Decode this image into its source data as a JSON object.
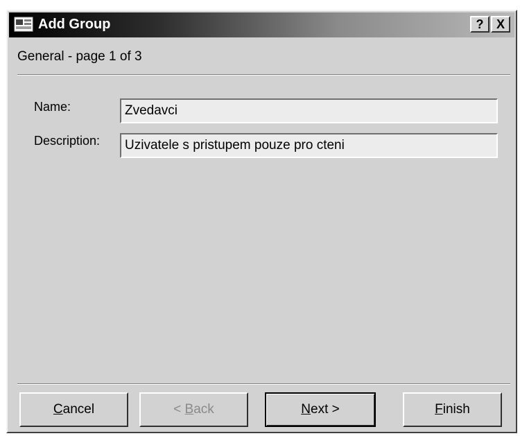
{
  "window": {
    "title": "Add Group",
    "icon": "window-app-icon",
    "help_label": "?",
    "close_label": "X"
  },
  "page": {
    "heading": "General - page 1 of 3"
  },
  "form": {
    "name_label": "Name:",
    "name_value": "Zvedavci",
    "description_label": "Description:",
    "description_value": "Uzivatele s pristupem pouze pro cteni"
  },
  "buttons": {
    "cancel": {
      "mnemonic": "C",
      "rest": "ancel"
    },
    "back": {
      "prefix": "< ",
      "mnemonic": "B",
      "rest": "ack",
      "enabled": false
    },
    "next": {
      "mnemonic": "N",
      "rest": "ext >"
    },
    "finish": {
      "mnemonic": "F",
      "rest": "inish"
    }
  }
}
